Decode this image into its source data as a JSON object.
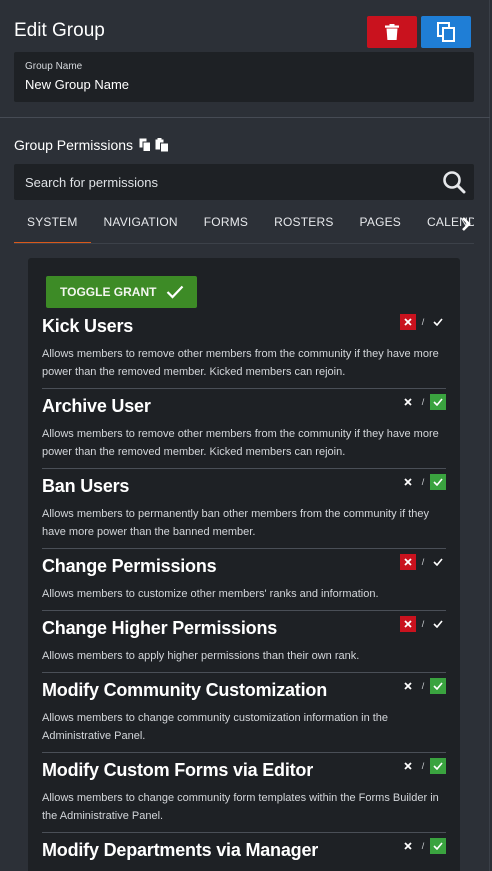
{
  "header": {
    "title": "Edit Group"
  },
  "group_name": {
    "label": "Group Name",
    "value": "New Group Name"
  },
  "permissions_title": "Group Permissions",
  "search": {
    "placeholder": "Search for permissions"
  },
  "tabs": [
    "SYSTEM",
    "NAVIGATION",
    "FORMS",
    "ROSTERS",
    "PAGES",
    "CALENDAR"
  ],
  "active_tab": "SYSTEM",
  "toggle_grant_label": "TOGGLE GRANT",
  "toggle_separator": "/",
  "colors": {
    "accent": "#d9591b",
    "delete": "#c9121e",
    "copy": "#1f7ed6",
    "grant": "#3d8b26",
    "grant_on": "#3aa33f"
  },
  "permissions": [
    {
      "name": "Kick Users",
      "desc": "Allows members to remove other members from the community if they have more power than the removed member. Kicked members can rejoin.",
      "state": "deny"
    },
    {
      "name": "Archive User",
      "desc": "Allows members to remove other members from the community if they have more power than the removed member. Kicked members can rejoin.",
      "state": "grant"
    },
    {
      "name": "Ban Users",
      "desc": "Allows members to permanently ban other members from the community if they have more power than the banned member.",
      "state": "grant"
    },
    {
      "name": "Change Permissions",
      "desc": "Allows members to customize other members' ranks and information.",
      "state": "deny"
    },
    {
      "name": "Change Higher Permissions",
      "desc": "Allows members to apply higher permissions than their own rank.",
      "state": "deny"
    },
    {
      "name": "Modify Community Customization",
      "desc": "Allows members to change community customization information in the Administrative Panel.",
      "state": "grant"
    },
    {
      "name": "Modify Custom Forms via Editor",
      "desc": "Allows members to change community form templates within the Forms Builder in the Administrative Panel.",
      "state": "grant"
    },
    {
      "name": "Modify Departments via Manager",
      "desc": "",
      "state": "grant"
    }
  ]
}
